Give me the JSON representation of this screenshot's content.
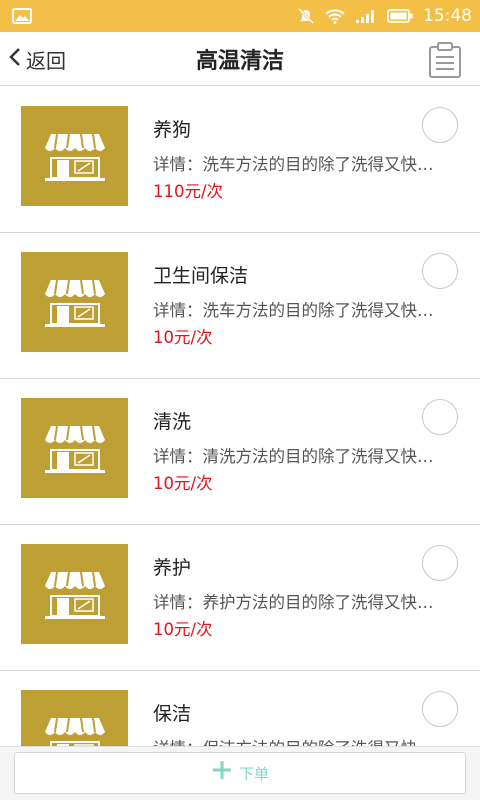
{
  "status_bar": {
    "time": "15:48",
    "icons": [
      "image-icon",
      "mute-icon",
      "wifi-icon",
      "signal-icon",
      "battery-icon"
    ]
  },
  "header": {
    "back_label": "返回",
    "title": "高温清洁",
    "right_icon": "clipboard-icon"
  },
  "items": [
    {
      "name": "养狗",
      "desc": "详情：洗车方法的目的除了洗得又快又干净",
      "price": "110元/次"
    },
    {
      "name": "卫生间保洁",
      "desc": "详情：洗车方法的目的除了洗得又快又干净",
      "price": "10元/次"
    },
    {
      "name": "清洗",
      "desc": "详情：清洗方法的目的除了洗得又快又干净",
      "price": "10元/次"
    },
    {
      "name": "养护",
      "desc": "详情：养护方法的目的除了洗得又快又干净",
      "price": "10元/次"
    },
    {
      "name": "保洁",
      "desc": "详情：保洁方法的目的除了洗得又快又干净",
      "price": ""
    }
  ],
  "footer": {
    "order_label": "下单"
  },
  "colors": {
    "status_bar": "#f4bf46",
    "thumb_bg": "#bd9f33",
    "price": "#e0141a",
    "accent": "#7fd7c8"
  }
}
